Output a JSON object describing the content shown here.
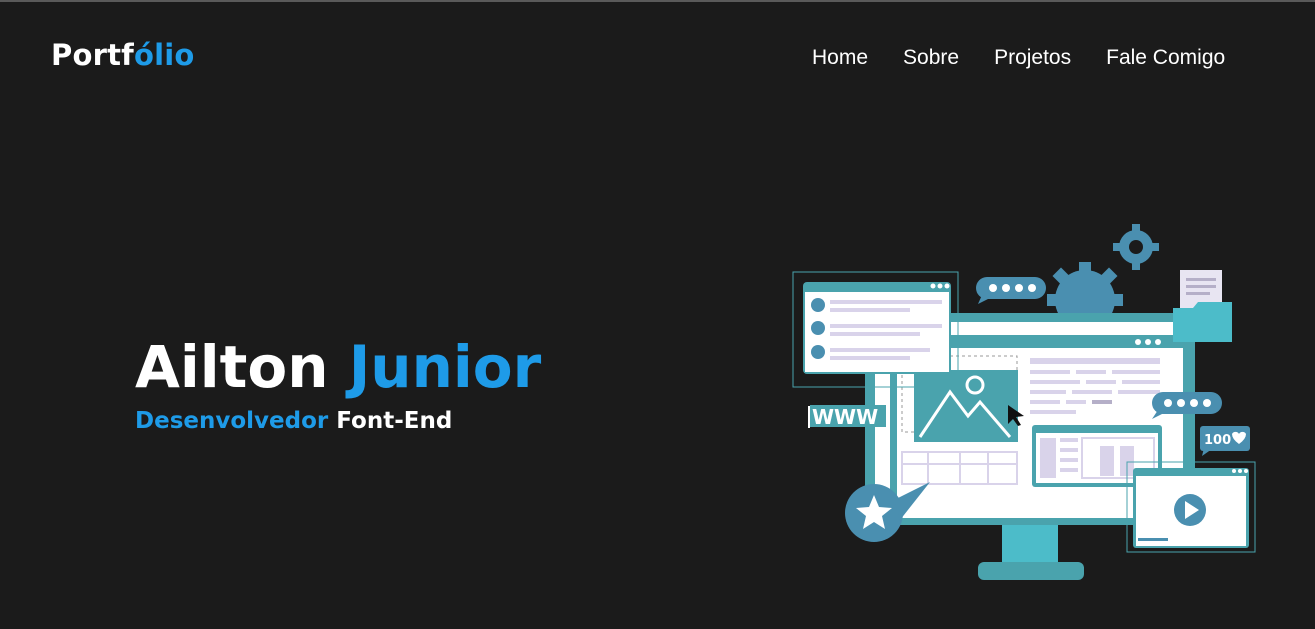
{
  "header": {
    "logo_main": "Portf",
    "logo_accent": "ólio",
    "nav": [
      {
        "label": "Home"
      },
      {
        "label": "Sobre"
      },
      {
        "label": "Projetos"
      },
      {
        "label": "Fale Comigo"
      }
    ]
  },
  "hero": {
    "first_name": "Ailton",
    "last_name": "Junior",
    "role_accent": "Desenvolvedor",
    "role_main": "Font-End"
  },
  "illustration": {
    "www_text": "WWW",
    "likes_text": "100"
  },
  "colors": {
    "accent": "#1e9be8",
    "background": "#1b1b1b",
    "teal": "#4aa3ad"
  }
}
